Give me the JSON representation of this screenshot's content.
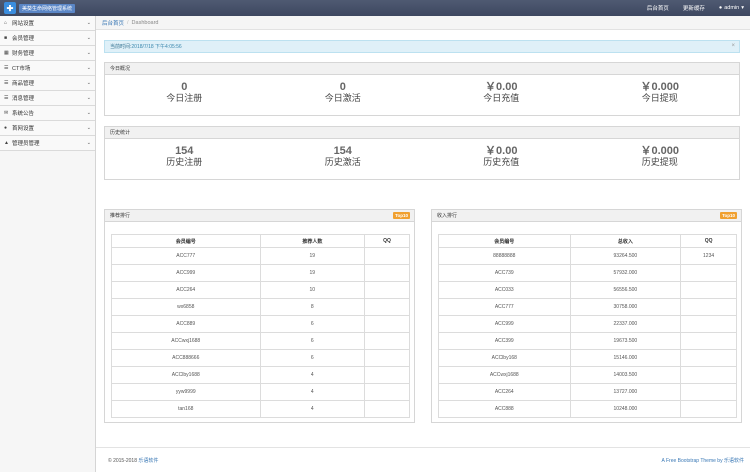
{
  "brand": {
    "logo_char": "✚",
    "title": "美葵生命网络管理系统"
  },
  "topnav": {
    "home": "后台首页",
    "cache": "更新缓存",
    "user": "admin"
  },
  "sidebar": {
    "items": [
      {
        "label": "网站设置",
        "icon": "home-icon"
      },
      {
        "label": "会员管理",
        "icon": "user-icon"
      },
      {
        "label": "财务管理",
        "icon": "calendar-icon"
      },
      {
        "label": "CT市场",
        "icon": "list-icon"
      },
      {
        "label": "商品管理",
        "icon": "list-icon"
      },
      {
        "label": "消息管理",
        "icon": "list-icon"
      },
      {
        "label": "系统公告",
        "icon": "message-icon"
      },
      {
        "label": "首网设置",
        "icon": "chat-icon"
      },
      {
        "label": "管理员管理",
        "icon": "person-icon"
      }
    ]
  },
  "breadcrumb": {
    "home": "后台首页",
    "current": "Dashboard"
  },
  "alert": {
    "label": "当前时间:",
    "value": "2018/7/18 下午4:05:56",
    "close": "×"
  },
  "today": {
    "title": "今日概况",
    "stats": [
      {
        "num": "0",
        "cap": "今日注册"
      },
      {
        "num": "0",
        "cap": "今日激活"
      },
      {
        "num": "￥0.00",
        "cap": "今日充值"
      },
      {
        "num": "￥0.000",
        "cap": "今日提现"
      }
    ]
  },
  "history": {
    "title": "历史统计",
    "stats": [
      {
        "num": "154",
        "cap": "历史注册"
      },
      {
        "num": "154",
        "cap": "历史激活"
      },
      {
        "num": "￥0.00",
        "cap": "历史充值"
      },
      {
        "num": "￥0.000",
        "cap": "历史提现"
      }
    ]
  },
  "recommend": {
    "title": "推荐排行",
    "badge": "Top10",
    "headers": [
      "会员编号",
      "推荐人数",
      "QQ"
    ],
    "rows": [
      [
        "ACC777",
        "19",
        ""
      ],
      [
        "ACC999",
        "19",
        ""
      ],
      [
        "ACC264",
        "10",
        ""
      ],
      [
        "wx6858",
        "8",
        ""
      ],
      [
        "ACC889",
        "6",
        ""
      ],
      [
        "ACCwxj1688",
        "6",
        ""
      ],
      [
        "ACC888666",
        "6",
        ""
      ],
      [
        "ACClby1688",
        "4",
        ""
      ],
      [
        "yyw9999",
        "4",
        ""
      ],
      [
        "tan168",
        "4",
        ""
      ]
    ]
  },
  "income": {
    "title": "收入排行",
    "badge": "Top10",
    "headers": [
      "会员编号",
      "总收入",
      "QQ"
    ],
    "rows": [
      [
        "88888888",
        "93264.500",
        "1234"
      ],
      [
        "ACC739",
        "57932.000",
        ""
      ],
      [
        "ACC033",
        "56556.500",
        ""
      ],
      [
        "ACC777",
        "30758.000",
        ""
      ],
      [
        "ACC999",
        "22337.000",
        ""
      ],
      [
        "ACC399",
        "19673.500",
        ""
      ],
      [
        "ACClby168",
        "15146.000",
        ""
      ],
      [
        "ACCwxj1688",
        "14003.500",
        ""
      ],
      [
        "ACC264",
        "13727.000",
        ""
      ],
      [
        "ACC888",
        "10248.000",
        ""
      ]
    ]
  },
  "footer": {
    "copyright": "© 2015-2018",
    "company": "乐语软件",
    "theme": "A Free Bootstrap Theme by",
    "theme_link": "乐语软件"
  }
}
